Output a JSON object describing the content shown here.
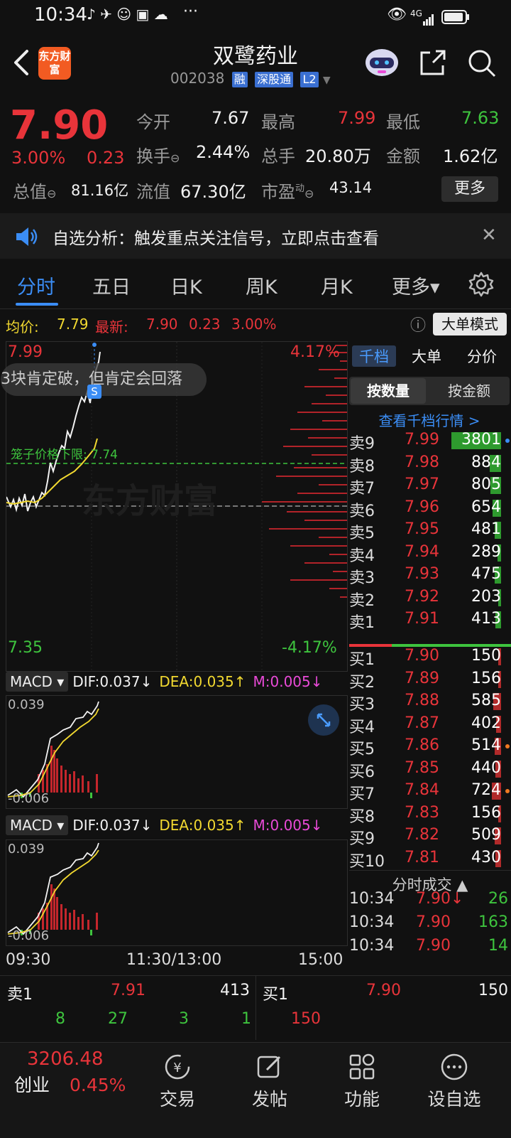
{
  "status_bar": {
    "time": "10:34",
    "more": "···",
    "network": "4G"
  },
  "header": {
    "back_icon": "chevron-left-icon",
    "logo_text": "东方财富",
    "stock_name": "双鹭药业",
    "stock_code": "002038",
    "badges": [
      "融",
      "深股通",
      "L2"
    ],
    "actions": [
      "robot-assistant-icon",
      "share-icon",
      "search-icon"
    ]
  },
  "quote": {
    "price": "7.90",
    "change_pct": "3.00%",
    "change_abs": "0.23",
    "open_label": "今开",
    "open": "7.67",
    "high_label": "最高",
    "high": "7.99",
    "low_label": "最低",
    "low": "7.63",
    "turnover_label": "换手",
    "turnover": "2.44%",
    "volume_label": "总手",
    "volume": "20.80万",
    "amount_label": "金额",
    "amount": "1.62亿",
    "mktcap_label": "总值",
    "mktcap": "81.16亿",
    "float_label": "流值",
    "float": "67.30亿",
    "pe_label": "市盈",
    "pe_sup": "动",
    "pe": "43.14",
    "more_label": "更多"
  },
  "notice": {
    "text": "自选分析：触发重点关注信号，立即点击查看"
  },
  "tabs": [
    {
      "label": "分时",
      "active": true
    },
    {
      "label": "五日"
    },
    {
      "label": "日K"
    },
    {
      "label": "周K"
    },
    {
      "label": "月K"
    },
    {
      "label": "更多▾"
    }
  ],
  "infoline": {
    "avg_label": "均价:",
    "avg": "7.79",
    "latest_label": "最新:",
    "latest": "7.90",
    "chg": "0.23",
    "pct": "3.00%",
    "mode_button": "大单模式"
  },
  "chart": {
    "top_price": "7.99",
    "top_pct": "4.17%",
    "bottom_price": "7.35",
    "bottom_pct": "-4.17%",
    "comment": "3块肯定破，但肯定会回落",
    "marker": "S",
    "limit_label": "笼子价格下限: 7.74",
    "watermark": "东方财富"
  },
  "macd": {
    "selector": "MACD",
    "dif": "DIF:0.037↓",
    "dea": "DEA:0.035↑",
    "m": "M:0.005↓",
    "top_value": "0.039",
    "bottom_value": "-0.006"
  },
  "axis": {
    "start": "09:30",
    "mid": "11:30/13:00",
    "end": "15:00"
  },
  "orderbook": {
    "tabs": [
      "千档",
      "大单",
      "分价"
    ],
    "subtabs": [
      "按数量",
      "按金额"
    ],
    "link": "查看千档行情 >",
    "asks": [
      {
        "label": "卖9",
        "price": "7.99",
        "vol": "3801"
      },
      {
        "label": "卖8",
        "price": "7.98",
        "vol": "884"
      },
      {
        "label": "卖7",
        "price": "7.97",
        "vol": "805"
      },
      {
        "label": "卖6",
        "price": "7.96",
        "vol": "654"
      },
      {
        "label": "卖5",
        "price": "7.95",
        "vol": "481"
      },
      {
        "label": "卖4",
        "price": "7.94",
        "vol": "289"
      },
      {
        "label": "卖3",
        "price": "7.93",
        "vol": "475"
      },
      {
        "label": "卖2",
        "price": "7.92",
        "vol": "203"
      },
      {
        "label": "卖1",
        "price": "7.91",
        "vol": "413"
      }
    ],
    "bids": [
      {
        "label": "买1",
        "price": "7.90",
        "vol": "150"
      },
      {
        "label": "买2",
        "price": "7.89",
        "vol": "156"
      },
      {
        "label": "买3",
        "price": "7.88",
        "vol": "585"
      },
      {
        "label": "买4",
        "price": "7.87",
        "vol": "402"
      },
      {
        "label": "买5",
        "price": "7.86",
        "vol": "514"
      },
      {
        "label": "买6",
        "price": "7.85",
        "vol": "440"
      },
      {
        "label": "买7",
        "price": "7.84",
        "vol": "724"
      },
      {
        "label": "买8",
        "price": "7.83",
        "vol": "156"
      },
      {
        "label": "买9",
        "price": "7.82",
        "vol": "509"
      },
      {
        "label": "买10",
        "price": "7.81",
        "vol": "430"
      }
    ],
    "trades_title": "分时成交 ▲",
    "trades": [
      {
        "time": "10:34",
        "price": "7.90↓",
        "vol": "26"
      },
      {
        "time": "10:34",
        "price": "7.90",
        "vol": "163"
      },
      {
        "time": "10:34",
        "price": "7.90",
        "vol": "14"
      }
    ]
  },
  "queue": {
    "sell_label": "卖1",
    "sell_price": "7.91",
    "sell_vol": "413",
    "buy_label": "买1",
    "buy_price": "7.90",
    "buy_vol": "150",
    "sell_queue": [
      "8",
      "27",
      "3",
      "1"
    ],
    "buy_queue": [
      "150"
    ]
  },
  "nav": {
    "index_value": "3206.48",
    "index_name": "创业",
    "index_pct": "0.45%",
    "items": [
      {
        "label": "交易",
        "icon": "trade-yen-icon"
      },
      {
        "label": "发帖",
        "icon": "compose-icon"
      },
      {
        "label": "功能",
        "icon": "grid-icon"
      },
      {
        "label": "设自选",
        "icon": "more-circle-icon"
      }
    ]
  }
}
